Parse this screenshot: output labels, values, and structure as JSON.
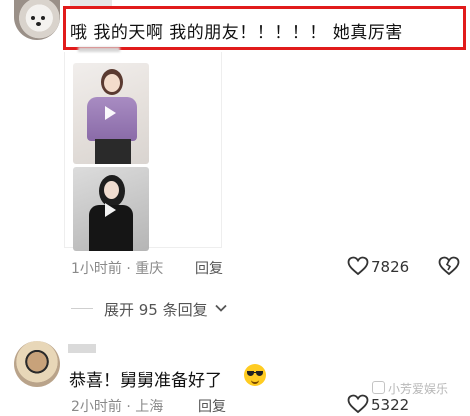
{
  "comment1": {
    "text": "哦 我的天啊 我的朋友！！！！！ 她真厉害",
    "time_location": "1小时前 · 重庆",
    "reply_label": "回复",
    "likes": "7826",
    "highlight_color": "#e11b1b"
  },
  "thread": {
    "expand_label": "展开 95 条回复"
  },
  "comment2": {
    "text": "恭喜！舅舅准备好了",
    "time_location": "2小时前 · 上海",
    "reply_label": "回复",
    "likes": "5322"
  },
  "watermark": "小芳爱娱乐",
  "icons": {
    "like": "heart-icon",
    "dislike": "broken-heart-icon",
    "expand": "chevron-down-icon",
    "media": "play-icon",
    "emoji": "sunglasses-emoji-icon"
  }
}
